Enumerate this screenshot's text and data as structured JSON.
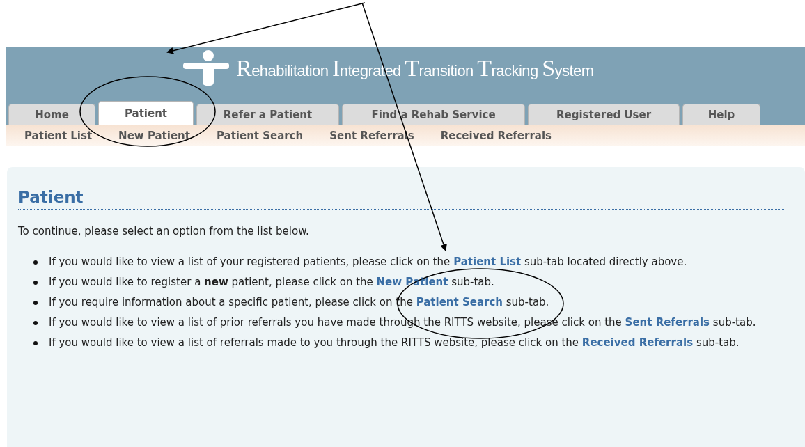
{
  "header": {
    "title": "Rehabilitation Integrated Transition Tracking System"
  },
  "tabs": [
    {
      "label": "Home",
      "selected": false
    },
    {
      "label": "Patient",
      "selected": true
    },
    {
      "label": "Refer a Patient",
      "selected": false
    },
    {
      "label": "Find a Rehab Service",
      "selected": false
    },
    {
      "label": "Registered User",
      "selected": false
    },
    {
      "label": "Help",
      "selected": false
    }
  ],
  "sub_tabs": [
    "Patient List",
    "New Patient",
    "Patient Search",
    "Sent Referrals",
    "Received Referrals"
  ],
  "content": {
    "heading": "Patient",
    "intro": "To continue, please select an option from the list below.",
    "items": [
      [
        {
          "text": "If you would like to view a list of your registered patients, please click on the "
        },
        {
          "link": "Patient List"
        },
        {
          "text": " sub-tab located directly above."
        }
      ],
      [
        {
          "text": "If you would like to register a **new** patient, please click on the "
        },
        {
          "link": "New Patient"
        },
        {
          "text": " sub-tab."
        }
      ],
      [
        {
          "text": "If you require information about a specific patient, please click on the "
        },
        {
          "link": "Patient Search"
        },
        {
          "text": " sub-tab."
        }
      ],
      [
        {
          "text": "If you would like to view a list of prior referrals you have made through the RITTS website, please click on the "
        },
        {
          "link": "Sent Referrals"
        },
        {
          "text": " sub-tab."
        }
      ],
      [
        {
          "text": "If you would like to view a list of referrals made to you through the RITTS website, please click on the "
        },
        {
          "link": "Received Referrals"
        },
        {
          "text": " sub-tab."
        }
      ]
    ]
  }
}
